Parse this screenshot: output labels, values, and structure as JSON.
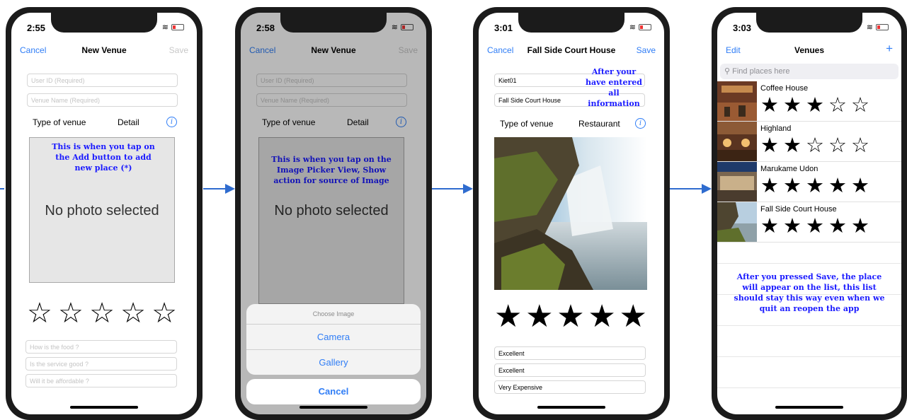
{
  "screen1": {
    "time": "2:55",
    "nav": {
      "left": "Cancel",
      "title": "New Venue",
      "right": "Save"
    },
    "fields": {
      "user_id_placeholder": "User ID (Required)",
      "venue_name_placeholder": "Venue Name (Required)"
    },
    "type_label": "Type of venue",
    "type_value": "Detail",
    "annotation": "This is when you tap on the Add button to add new place (*)",
    "photo_text": "No photo selected",
    "rating": 0,
    "questions": [
      "How is the food ?",
      "Is the service good ?",
      "Will it be affordable ?"
    ]
  },
  "screen2": {
    "time": "2:58",
    "nav": {
      "left": "Cancel",
      "title": "New Venue",
      "right": "Save"
    },
    "fields": {
      "user_id_placeholder": "User ID (Required)",
      "venue_name_placeholder": "Venue Name (Required)"
    },
    "type_label": "Type of venue",
    "type_value": "Detail",
    "annotation": "This is when you tap on the Image Picker View, Show action for source of Image",
    "photo_text": "No photo selected",
    "sheet": {
      "title": "Choose Image",
      "options": [
        "Camera",
        "Gallery"
      ],
      "cancel": "Cancel"
    }
  },
  "screen3": {
    "time": "3:01",
    "nav": {
      "left": "Cancel",
      "title": "Fall Side Court House",
      "right": "Save"
    },
    "fields": {
      "user_id": "Kiet01",
      "venue_name": "Fall Side Court House"
    },
    "annotation": "After your have entered all information",
    "type_label": "Type of venue",
    "type_value": "Restaurant",
    "rating": 5,
    "answers": [
      "Excellent",
      "Excellent",
      "Very Expensive"
    ]
  },
  "screen4": {
    "time": "3:03",
    "nav": {
      "left": "Edit",
      "title": "Venues",
      "right": "+"
    },
    "search_placeholder": "Find places here",
    "venues": [
      {
        "name": "Coffee House",
        "rating": 3
      },
      {
        "name": "Highland",
        "rating": 2
      },
      {
        "name": "Marukame Udon",
        "rating": 5
      },
      {
        "name": "Fall Side Court House",
        "rating": 5
      }
    ],
    "annotation": "After you pressed Save, the place will appear on the list, this list should stay this way even when we quit an reopen the app"
  },
  "colors": {
    "ios_blue": "#2f7df6",
    "annotation_blue": "#1a1aff",
    "arrow": "#2f6ccf",
    "phone_bezel": "#1b1b1b"
  }
}
